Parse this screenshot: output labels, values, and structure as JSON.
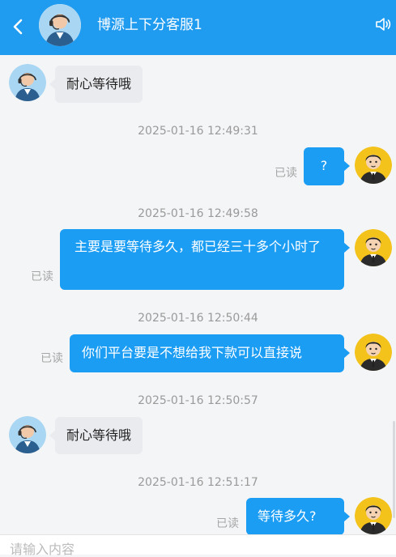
{
  "header": {
    "back_icon": "chevron-left-icon",
    "title": "博源上下分客服1",
    "speaker_icon": "speaker-icon",
    "bg_color": "#1f9bf0"
  },
  "messages": [
    {
      "side": "in",
      "text": "耐心等待哦"
    },
    {
      "timestamp": "2025-01-16 12:49:31"
    },
    {
      "side": "out",
      "text": "?",
      "status": "已读"
    },
    {
      "timestamp": "2025-01-16 12:49:58"
    },
    {
      "side": "out",
      "text": "主要是要等待多久，都已经三十多个小时了",
      "status": "已读"
    },
    {
      "timestamp": "2025-01-16 12:50:44"
    },
    {
      "side": "out",
      "text": "你们平台要是不想给我下款可以直接说",
      "status": "已读"
    },
    {
      "timestamp": "2025-01-16 12:50:57"
    },
    {
      "side": "in",
      "text": "耐心等待哦"
    },
    {
      "timestamp": "2025-01-16 12:51:17"
    },
    {
      "side": "out",
      "text": "等待多久?",
      "status": "已读"
    }
  ],
  "input": {
    "placeholder": "请输入内容"
  },
  "colors": {
    "out_bubble": "#1b9df4",
    "in_bubble": "#e9ebee",
    "background": "#f4f5f7"
  }
}
